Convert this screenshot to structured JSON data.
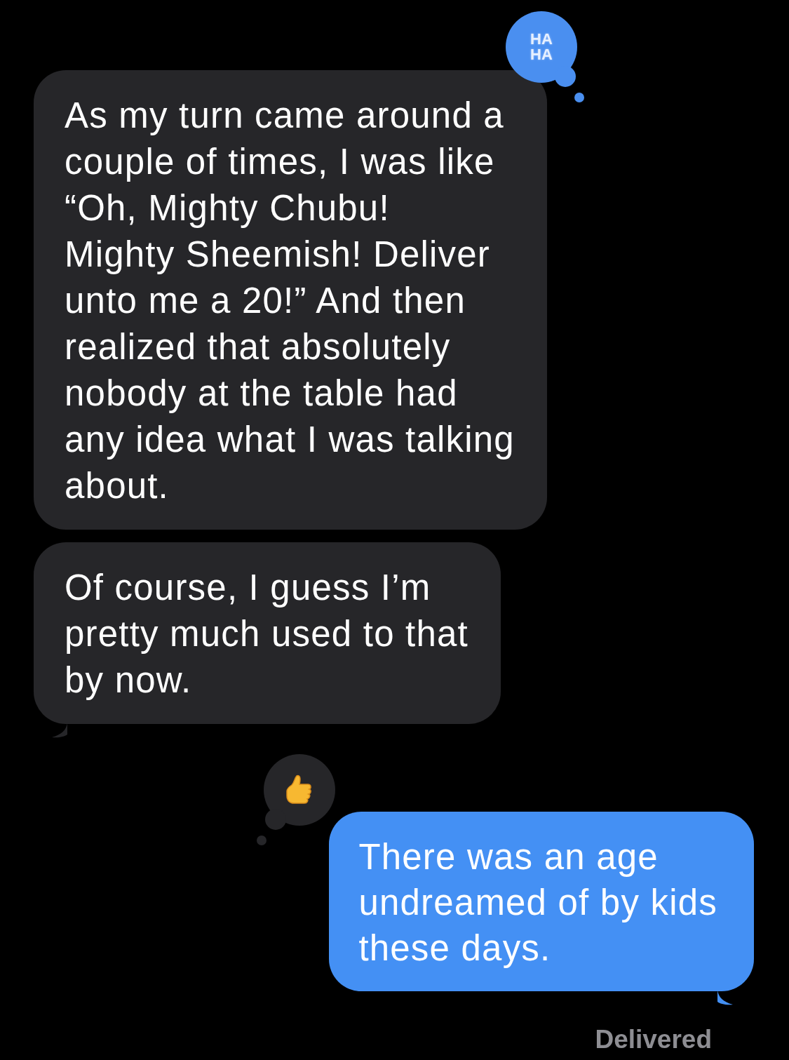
{
  "messages": [
    {
      "kind": "incoming",
      "tail": false,
      "lines": [
        "As my turn came around a",
        "couple of times, I was like",
        "“Oh, Mighty Chubu!",
        "Mighty Sheemish! Deliver",
        "unto me a 20!” And then",
        "realized that absolutely",
        "nobody at the table had",
        "any idea what I was talking",
        "about."
      ],
      "tapback": {
        "kind": "haha",
        "label": "HA HA"
      }
    },
    {
      "kind": "incoming",
      "tail": true,
      "lines": [
        "Of course, I guess I’m",
        "pretty much used to that",
        "by now."
      ]
    },
    {
      "kind": "outgoing",
      "tail": true,
      "lines": [
        "There was an age",
        "undreamed of by kids",
        "these days."
      ],
      "tapback": {
        "kind": "thumbs_up"
      }
    }
  ],
  "status": "Delivered"
}
